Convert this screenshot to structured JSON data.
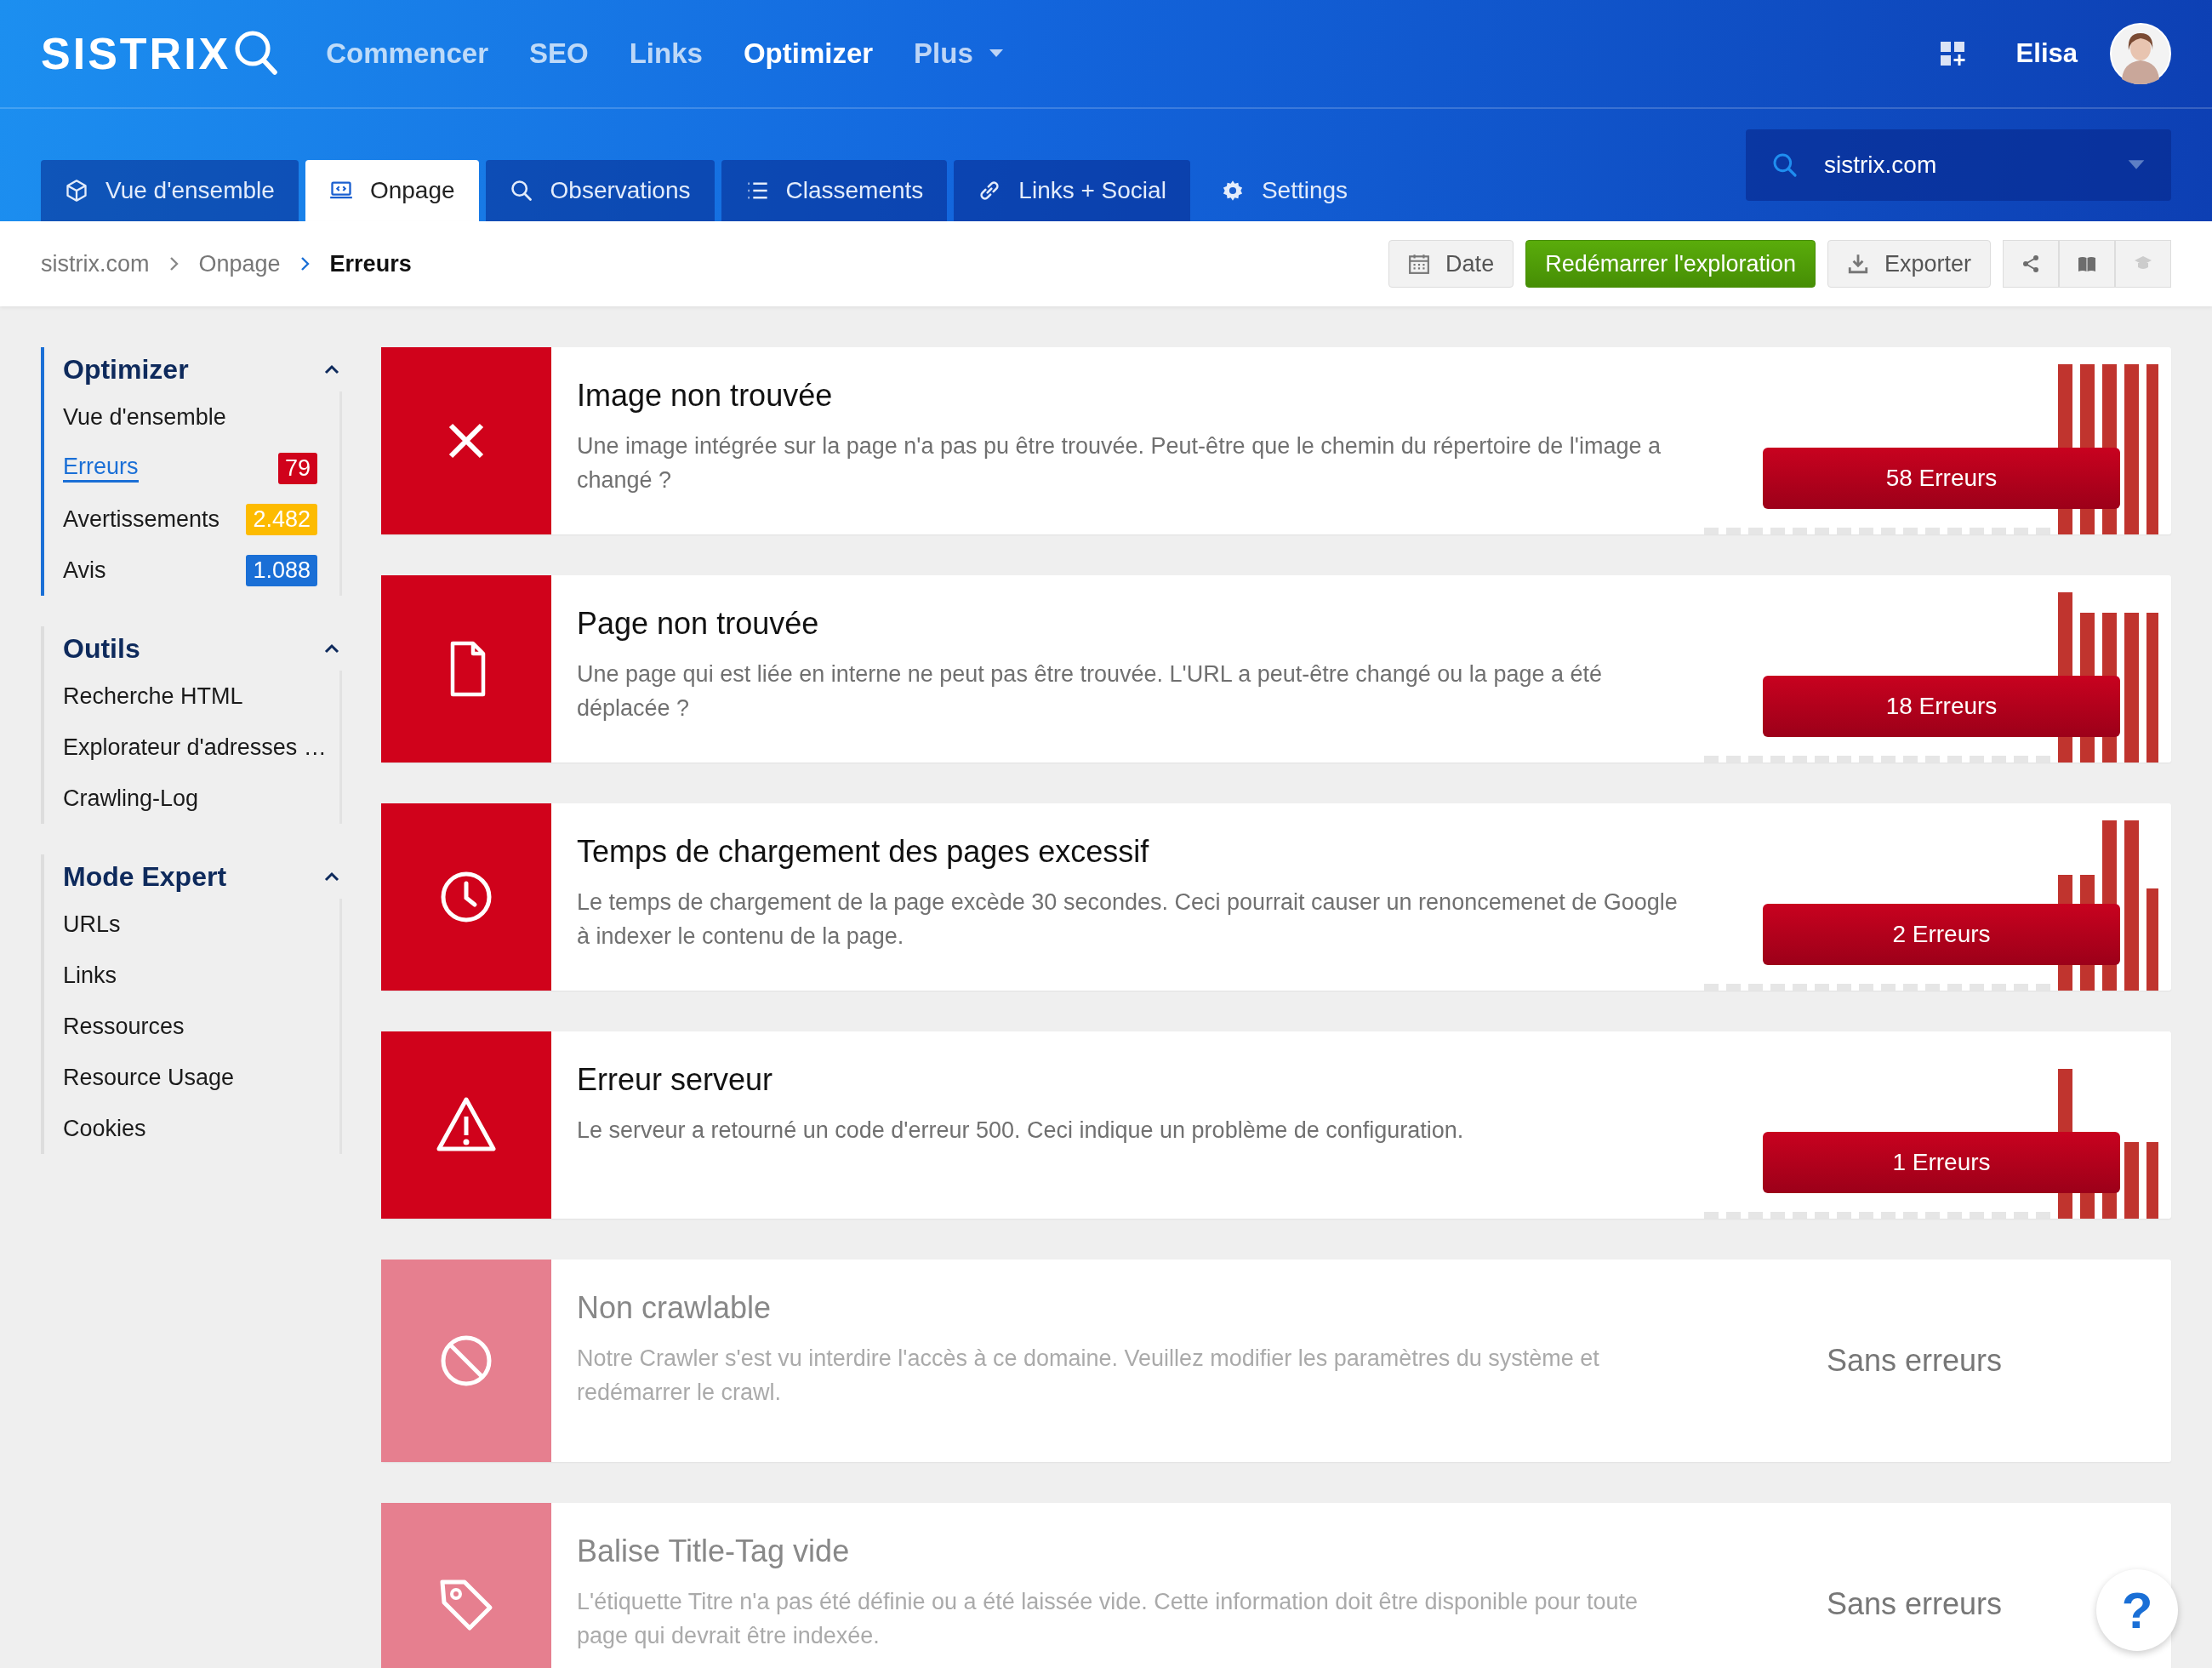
{
  "header": {
    "logo": "SISTRIX",
    "nav": [
      {
        "label": "Commencer",
        "selected": false
      },
      {
        "label": "SEO",
        "selected": false
      },
      {
        "label": "Links",
        "selected": false
      },
      {
        "label": "Optimizer",
        "selected": true
      },
      {
        "label": "Plus",
        "selected": false,
        "dropdown": true
      }
    ],
    "user": "Elisa"
  },
  "tabs": [
    {
      "label": "Vue d'ensemble",
      "selected": false
    },
    {
      "label": "Onpage",
      "selected": true
    },
    {
      "label": "Observations",
      "selected": false
    },
    {
      "label": "Classements",
      "selected": false
    },
    {
      "label": "Links + Social",
      "selected": false
    },
    {
      "label": "Settings",
      "selected": false,
      "kind": "plain"
    }
  ],
  "project_selector": {
    "value": "sistrix.com"
  },
  "breadcrumb": [
    "sistrix.com",
    "Onpage",
    "Erreurs"
  ],
  "toolbar": [
    {
      "kind": "button",
      "label": "Date"
    },
    {
      "kind": "primary",
      "label": "Redémarrer l'exploration"
    },
    {
      "kind": "button",
      "label": "Exporter"
    },
    {
      "kind": "icon",
      "disabled": false
    },
    {
      "kind": "icon",
      "disabled": false
    },
    {
      "kind": "icon",
      "disabled": true
    }
  ],
  "sidebar": [
    {
      "title": "Optimizer",
      "expanded": true,
      "active": true,
      "items": [
        {
          "label": "Vue d'ensemble",
          "selected": false
        },
        {
          "label": "Erreurs",
          "selected": true,
          "badge": "79",
          "color": "#d0021b"
        },
        {
          "label": "Avertissements",
          "selected": false,
          "badge": "2.482",
          "color": "#fdbb00"
        },
        {
          "label": "Avis",
          "selected": false,
          "badge": "1.088",
          "color": "#1a6fd6"
        }
      ]
    },
    {
      "title": "Outils",
      "expanded": true,
      "active": false,
      "items": [
        {
          "label": "Recherche HTML",
          "selected": false
        },
        {
          "label": "Explorateur d'adresses …",
          "selected": false
        },
        {
          "label": "Crawling-Log",
          "selected": false
        }
      ]
    },
    {
      "title": "Mode Expert",
      "expanded": true,
      "active": false,
      "items": [
        {
          "label": "URLs",
          "selected": false
        },
        {
          "label": "Links",
          "selected": false
        },
        {
          "label": "Ressources",
          "selected": false
        },
        {
          "label": "Resource Usage",
          "selected": false
        },
        {
          "label": "Cookies",
          "selected": false
        }
      ]
    }
  ],
  "issues": [
    {
      "kind": "error",
      "title": "Image non trouvée",
      "description": "Une image intégrée sur la page n'a pas pu être trouvée. Peut-être que le chemin du répertoire de l'image a changé ?",
      "result": "58 Erreurs"
    },
    {
      "kind": "error",
      "title": "Page non trouvée",
      "description": "Une page qui est liée en interne ne peut pas être trouvée. L'URL a peut-être changé ou la page a été déplacée ?",
      "result": "18 Erreurs"
    },
    {
      "kind": "error",
      "title": "Temps de chargement des pages excessif",
      "description": "Le temps de chargement de la page excède 30 secondes. Ceci pourrait causer un renoncemenet de Google à indexer le contenu de la page.",
      "result": "2 Erreurs"
    },
    {
      "kind": "error",
      "title": "Erreur serveur",
      "description": "Le serveur a retourné un code d'erreur 500. Ceci indique un problème de configuration.",
      "result": "1 Erreurs"
    },
    {
      "kind": "clean",
      "title": "Non crawlable",
      "description": "Notre Crawler s'est vu interdire l'accès à ce domaine. Veuillez modifier les paramètres du système et redémarrer le crawl.",
      "result": "Sans erreurs"
    },
    {
      "kind": "clean",
      "title": "Balise Title-Tag vide",
      "description": "L'étiquette Titre n'a pas été définie ou a été laissée vide. Cette information doit être disponible pour toute page qui devrait être indexée.",
      "result": "Sans erreurs"
    }
  ],
  "help": {
    "label": "?"
  }
}
